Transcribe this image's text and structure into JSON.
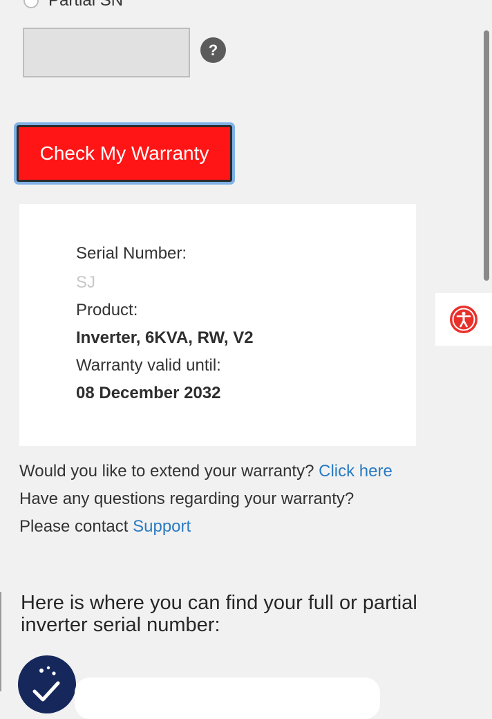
{
  "form": {
    "partial_label": "Partial SN",
    "input_value": "",
    "help_symbol": "?",
    "check_button_label": "Check My Warranty"
  },
  "result": {
    "serial_label": "Serial Number:",
    "serial_value": "SJ",
    "product_label": "Product:",
    "product_value": "Inverter, 6KVA, RW, V2",
    "warranty_label": "Warranty valid until:",
    "warranty_value": "08 December 2032"
  },
  "info": {
    "extend_question": "Would you like to extend your warranty? ",
    "extend_link": "Click here",
    "questions_line": "Have any questions regarding your warranty?",
    "contact_prefix": "Please contact ",
    "support_link": "Support"
  },
  "find": {
    "heading": "Here is where you can find your full or partial inverter serial number:"
  },
  "icons": {
    "help": "question-circle-icon",
    "accessibility": "accessibility-icon",
    "badge": "checklist-badge-icon"
  },
  "colors": {
    "primary_button": "#ff1515",
    "link": "#2a7bc4",
    "accessibility": "#e8302a",
    "badge": "#16275c"
  }
}
